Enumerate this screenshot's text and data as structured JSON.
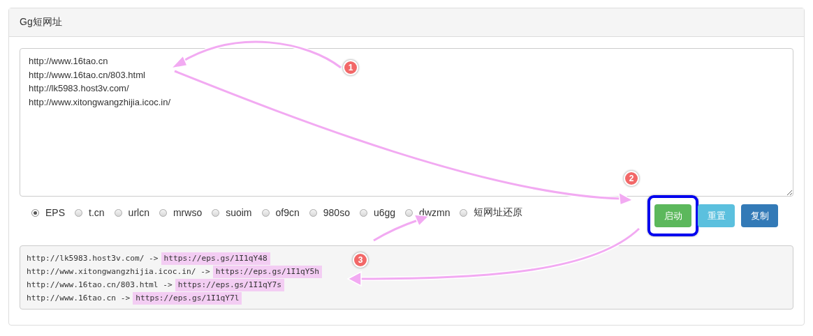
{
  "panel": {
    "title": "Gg短网址"
  },
  "input": {
    "value": "http://www.16tao.cn\nhttp://www.16tao.cn/803.html\nhttp://lk5983.host3v.com/\nhttp://www.xitongwangzhijia.icoc.in/"
  },
  "services": [
    {
      "label": "EPS",
      "selected": true
    },
    {
      "label": "t.cn",
      "selected": false
    },
    {
      "label": "urlcn",
      "selected": false
    },
    {
      "label": "mrwso",
      "selected": false
    },
    {
      "label": "suoim",
      "selected": false
    },
    {
      "label": "of9cn",
      "selected": false
    },
    {
      "label": "980so",
      "selected": false
    },
    {
      "label": "u6gg",
      "selected": false
    },
    {
      "label": "dwzmn",
      "selected": false
    },
    {
      "label": "短网址还原",
      "selected": false
    }
  ],
  "buttons": [
    {
      "label": "启动",
      "kind": "success",
      "highlighted": true
    },
    {
      "label": "重置",
      "kind": "info",
      "highlighted": false
    },
    {
      "label": "复制",
      "kind": "primary",
      "highlighted": false
    }
  ],
  "results": [
    {
      "source": "http://lk5983.host3v.com/ ->",
      "short": "https://eps.gs/1I1qY48"
    },
    {
      "source": "http://www.xitongwangzhijia.icoc.in/ ->",
      "short": "https://eps.gs/1I1qY5h"
    },
    {
      "source": "http://www.16tao.cn/803.html ->",
      "short": "https://eps.gs/1I1qY7s"
    },
    {
      "source": "http://www.16tao.cn ->",
      "short": "https://eps.gs/1I1qY7l"
    }
  ],
  "annotations": [
    {
      "label": "1"
    },
    {
      "label": "2"
    },
    {
      "label": "3"
    }
  ]
}
